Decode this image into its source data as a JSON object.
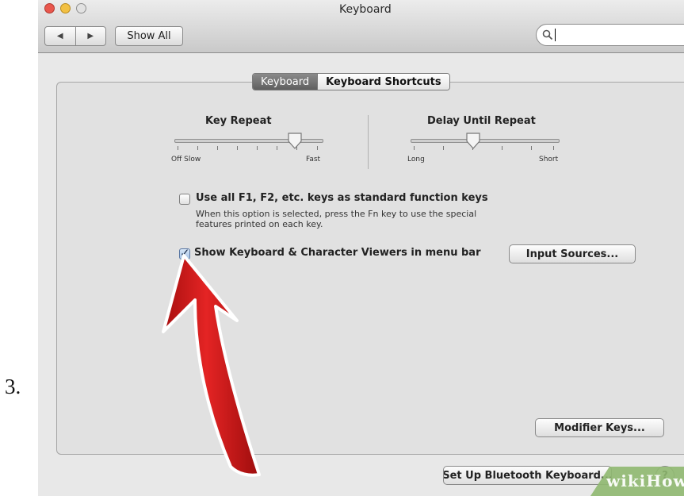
{
  "step_number": "3.",
  "window": {
    "title": "Keyboard"
  },
  "toolbar": {
    "back_glyph": "◀",
    "forward_glyph": "▶",
    "show_all_label": "Show All",
    "search_value": ""
  },
  "tabs": [
    {
      "label": "Keyboard",
      "active": true
    },
    {
      "label": "Keyboard Shortcuts",
      "active": false
    }
  ],
  "key_repeat": {
    "title": "Key Repeat",
    "left_labels": "Off  Slow",
    "right_label": "Fast",
    "level": 0.8
  },
  "delay_until_repeat": {
    "title": "Delay Until Repeat",
    "left_label": "Long",
    "right_label": "Short",
    "level": 0.4
  },
  "function_keys": {
    "label": "Use all F1, F2, etc. keys as standard function keys",
    "help_line1": "When this option is selected, press the Fn key to use the special",
    "help_line2": "features printed on each key.",
    "checked": false
  },
  "viewers": {
    "label": "Show Keyboard & Character Viewers in menu bar",
    "checked": true
  },
  "buttons": {
    "input_sources": "Input Sources...",
    "modifier_keys": "Modifier Keys...",
    "bluetooth": "Set Up Bluetooth Keyboard...",
    "help": "?"
  },
  "watermark": "wikiHow",
  "colors": {
    "arrow": "#d21a1a",
    "watermark_bg": "#8fb870"
  },
  "icons": {
    "search": "magnifier-icon",
    "arrow": "red-pointer-arrow"
  }
}
